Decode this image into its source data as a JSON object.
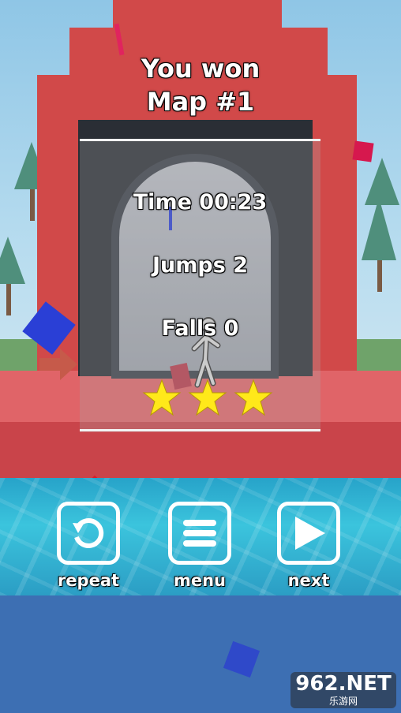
{
  "title": {
    "line1": "You won",
    "line2": "Map #1"
  },
  "stats": {
    "time": "Time 00:23",
    "jumps": "Jumps 2",
    "falls": "Falls 0"
  },
  "stars": {
    "earned": 3,
    "total": 3,
    "color": "#ffe81a"
  },
  "buttons": {
    "repeat_label": "repeat",
    "menu_label": "menu",
    "next_label": "next",
    "repeat_icon": "refresh-icon",
    "menu_icon": "hamburger-menu-icon",
    "next_icon": "play-icon"
  },
  "watermark": {
    "main": "962.NET",
    "sub": "乐游网"
  },
  "colors": {
    "tower": "#d14949",
    "water": "#3bc4dd",
    "button_border": "#ffffff"
  }
}
